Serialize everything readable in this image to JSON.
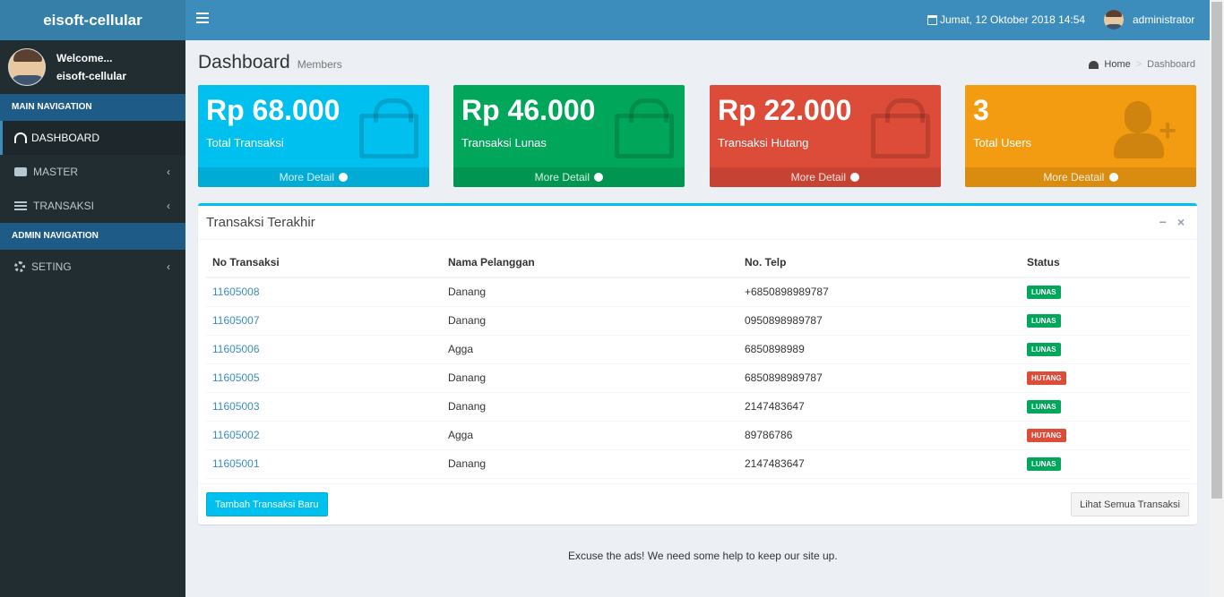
{
  "brand": "eisoft-cellular",
  "navbar": {
    "datetime": "Jumat, 12 Oktober 2018 14:54",
    "username": "administrator"
  },
  "sidebar": {
    "welcome": "Welcome...",
    "user": "eisoft-cellular",
    "main_header": "MAIN NAVIGATION",
    "items": [
      {
        "label": "DASHBOARD",
        "icon": "dashboard-icon"
      },
      {
        "label": "MASTER",
        "icon": "briefcase-icon"
      },
      {
        "label": "TRANSAKSI",
        "icon": "table-icon"
      }
    ],
    "admin_header": "ADMIN NAVIGATION",
    "admin_items": [
      {
        "label": "SETING",
        "icon": "gears-icon"
      }
    ]
  },
  "header": {
    "title": "Dashboard",
    "subtitle": "Members",
    "breadcrumb": [
      "Home",
      "Dashboard"
    ]
  },
  "stats": [
    {
      "value": "Rp 68.000",
      "label": "Total Transaksi",
      "footer": "More Detail",
      "color": "#00c0ef",
      "icon": "shopping-bag-icon"
    },
    {
      "value": "Rp 46.000",
      "label": "Transaksi Lunas",
      "footer": "More Detail",
      "color": "#00a65a",
      "icon": "shopping-bag-icon"
    },
    {
      "value": "Rp 22.000",
      "label": "Transaksi Hutang",
      "footer": "More Detail",
      "color": "#dd4b39",
      "icon": "shopping-bag-icon"
    },
    {
      "value": "3",
      "label": "Total Users",
      "footer": "More Deatail",
      "color": "#f39c12",
      "icon": "user-plus-icon"
    }
  ],
  "recent": {
    "title": "Transaksi Terakhir",
    "columns": [
      "No Transaksi",
      "Nama Pelanggan",
      "No. Telp",
      "Status"
    ],
    "rows": [
      {
        "id": "11605008",
        "name": "Danang",
        "phone": "+6850898989787",
        "status": "LUNAS"
      },
      {
        "id": "11605007",
        "name": "Danang",
        "phone": "0950898989787",
        "status": "LUNAS"
      },
      {
        "id": "11605006",
        "name": "Agga",
        "phone": "6850898989",
        "status": "LUNAS"
      },
      {
        "id": "11605005",
        "name": "Danang",
        "phone": "6850898989787",
        "status": "HUTANG"
      },
      {
        "id": "11605003",
        "name": "Danang",
        "phone": "2147483647",
        "status": "LUNAS"
      },
      {
        "id": "11605002",
        "name": "Agga",
        "phone": "89786786",
        "status": "HUTANG"
      },
      {
        "id": "11605001",
        "name": "Danang",
        "phone": "2147483647",
        "status": "LUNAS"
      }
    ],
    "btn_new": "Tambah Transaksi Baru",
    "btn_all": "Lihat Semua Transaksi"
  },
  "ads_text": "Excuse the ads! We need some help to keep our site up."
}
